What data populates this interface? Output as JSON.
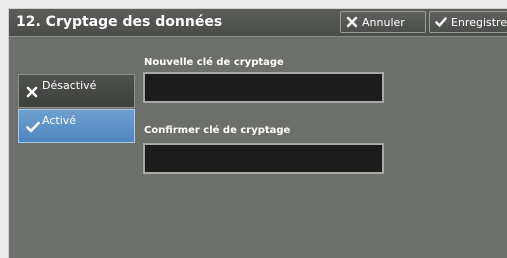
{
  "header": {
    "title": "12. Cryptage des données",
    "cancel_label": "Annuler",
    "save_label": "Enregistrer"
  },
  "options": {
    "disabled_label": "Désactivé",
    "enabled_label": "Activé",
    "selected": "Activé"
  },
  "fields": {
    "new_key_label": "Nouvelle clé de cryptage",
    "new_key_value": "",
    "confirm_key_label": "Confirmer clé de cryptage",
    "confirm_key_value": ""
  },
  "icons": {
    "cancel": "close-icon",
    "save": "checkmark-icon",
    "disabled": "close-icon",
    "enabled": "checkmark-icon"
  },
  "colors": {
    "panel": "#6d6f6b",
    "header": "#4f514e",
    "selected": "#5a8fc6",
    "field": "#1b1c1b"
  }
}
